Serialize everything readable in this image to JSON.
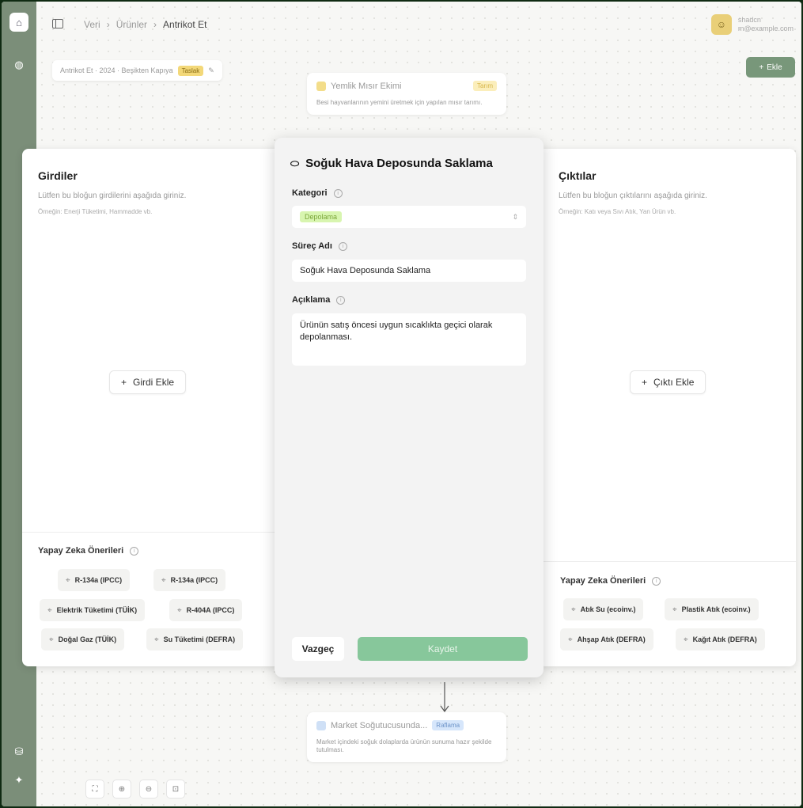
{
  "breadcrumb": [
    "Veri",
    "Ürünler",
    "Antrikot Et"
  ],
  "user": {
    "name": "shadcn",
    "email": "m@example.com"
  },
  "project": {
    "label": "Antrikot Et · 2024 · Beşikten Kapıya",
    "badge": "Taslak"
  },
  "toolbar": {
    "add_label": "Ekle"
  },
  "nodes": {
    "top": {
      "title": "Yemlik Mısır Ekimi",
      "badge": "Tarım",
      "desc": "Besi hayvanlarının yemini üretmek için yapılan mısır tarımı."
    },
    "bottom": {
      "title": "Market Soğutucusunda...",
      "badge": "Raflama",
      "desc": "Market içindeki soğuk dolaplarda ürünün sunuma hazır şekilde tutulması."
    }
  },
  "inputs_panel": {
    "title": "Girdiler",
    "subtitle": "Lütfen bu bloğun girdilerini aşağıda giriniz.",
    "example": "Örneğin: Enerji Tüketimi, Hammadde vb.",
    "add_label": "Girdi Ekle",
    "ai_title": "Yapay Zeka Önerileri",
    "suggestions": [
      "R-134a (IPCC)",
      "R-134a (IPCC)",
      "Elektrik Tüketimi (TÜİK)",
      "R-404A (IPCC)",
      "Doğal Gaz (TÜİK)",
      "Su Tüketimi (DEFRA)"
    ]
  },
  "outputs_panel": {
    "title": "Çıktılar",
    "subtitle": "Lütfen bu bloğun çıktılarını aşağıda giriniz.",
    "example": "Örneğin: Katı veya Sıvı Atık, Yan Ürün vb.",
    "add_label": "Çıktı Ekle",
    "ai_title": "Yapay Zeka Önerileri",
    "suggestions": [
      "Atık Su (ecoinv.)",
      "Plastik Atık (ecoinv.)",
      "Ahşap Atık (DEFRA)",
      "Kağıt Atık (DEFRA)"
    ]
  },
  "modal": {
    "title": "Soğuk Hava Deposunda Saklama",
    "category_label": "Kategori",
    "category_value": "Depolama",
    "process_label": "Süreç Adı",
    "process_value": "Soğuk Hava Deposunda Saklama",
    "desc_label": "Açıklama",
    "desc_value": "Ürünün satış öncesi uygun sıcaklıkta geçici olarak depolanması.",
    "cancel_label": "Vazgeç",
    "save_label": "Kaydet"
  },
  "colors": {
    "accent": "#78977a",
    "rail": "#7b8e79",
    "save": "#87c79b"
  }
}
